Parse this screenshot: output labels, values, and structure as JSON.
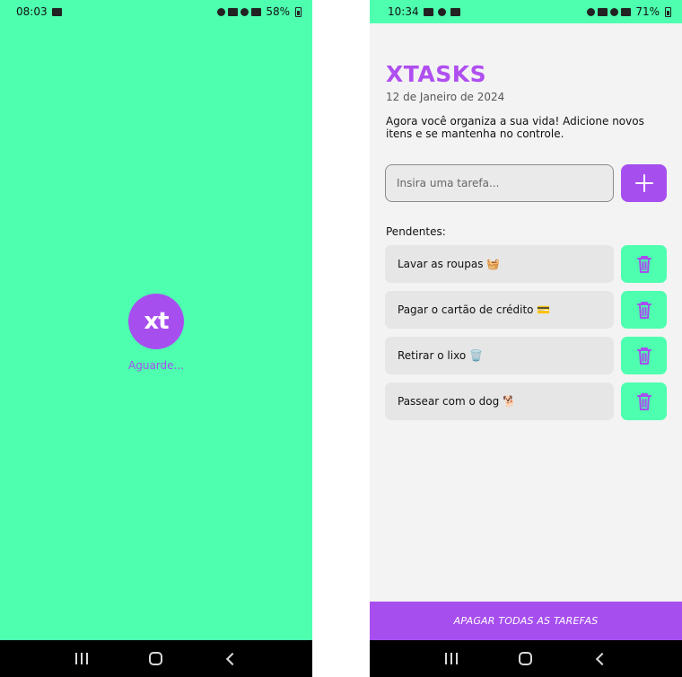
{
  "splash": {
    "status_time": "08:03",
    "status_battery": "58%",
    "logo_text": "xt",
    "wait_text": "Aguarde..."
  },
  "app": {
    "status_time": "10:34",
    "status_battery": "71%",
    "title": "XTASKS",
    "date": "12 de Janeiro de 2024",
    "description": "Agora você organiza a sua vida! Adicione novos itens e se mantenha no controle.",
    "input_placeholder": "Insira uma tarefa...",
    "pending_label": "Pendentes:",
    "tasks": [
      {
        "text": "Lavar as roupas 🧺"
      },
      {
        "text": "Pagar o cartão de crédito 💳"
      },
      {
        "text": "Retirar o lixo 🗑️"
      },
      {
        "text": "Passear com o dog 🐕"
      }
    ],
    "clear_all_label": "APAGAR TODAS AS TAREFAS"
  },
  "colors": {
    "accent_purple": "#a74eef",
    "accent_green": "#4dffae",
    "background": "#f3f3f3"
  },
  "icons": [
    "add-icon",
    "trash-icon",
    "nav-recent-icon",
    "nav-home-icon",
    "nav-back-icon"
  ]
}
